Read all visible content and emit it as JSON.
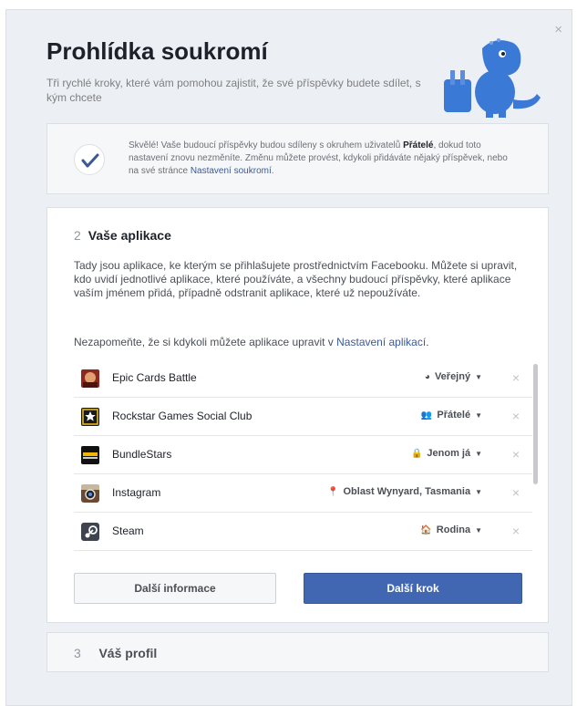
{
  "dialog": {
    "close_glyph": "×",
    "title": "Prohlídka soukromí",
    "subtitle": "Tři rychlé kroky, které vám pomohou zajistit, že své příspěvky budete sdílet, s kým chcete"
  },
  "notice": {
    "text_prefix": "Skvělé! Vaše budoucí příspěvky budou sdíleny s okruhem uživatelů ",
    "audience": "Přátelé",
    "text_middle": ", dokud toto nastavení znovu nezměníte. Změnu můžete provést, kdykoli přidáváte nějaký příspěvek, nebo na své stránce ",
    "link": "Nastavení soukromí",
    "text_suffix": "."
  },
  "step2": {
    "number": "2",
    "title": "Vaše aplikace",
    "description": "Tady jsou aplikace, ke kterým se přihlašujete prostřednictvím Facebooku. Můžete si upravit, kdo uvidí jednotlivé aplikace, které používáte, a všechny budoucí příspěvky, které aplikace vaším jménem přidá, případně odstranit aplikace, které už nepoužíváte.",
    "reminder_prefix": "Nezapomeňte, že si kdykoli můžete aplikace upravit v ",
    "reminder_link": "Nastavení aplikací",
    "reminder_suffix": "."
  },
  "apps": [
    {
      "name": "Epic Cards Battle",
      "audience": "Veřejný",
      "audience_icon": "globe-icon",
      "icon": "epic-cards-app-icon"
    },
    {
      "name": "Rockstar Games Social Club",
      "audience": "Přátelé",
      "audience_icon": "friends-icon",
      "icon": "rockstar-app-icon"
    },
    {
      "name": "BundleStars",
      "audience": "Jenom já",
      "audience_icon": "lock-icon",
      "icon": "bundlestars-app-icon"
    },
    {
      "name": "Instagram",
      "audience": "Oblast Wynyard, Tasmania",
      "audience_icon": "location-pin-icon",
      "icon": "instagram-app-icon"
    },
    {
      "name": "Steam",
      "audience": "Rodina",
      "audience_icon": "house-icon",
      "icon": "steam-app-icon"
    }
  ],
  "buttons": {
    "more_info": "Další informace",
    "next_step": "Další krok"
  },
  "step3": {
    "number": "3",
    "title": "Váš profil"
  },
  "colors": {
    "accent": "#4267b2",
    "link": "#3b5998",
    "mascot": "#3b79d6"
  }
}
